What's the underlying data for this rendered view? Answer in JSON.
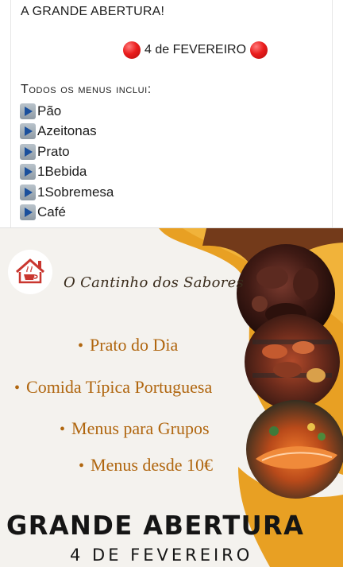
{
  "post": {
    "headline": "A GRANDE ABERTURA!",
    "date_text": "4 de FEVEREIRO",
    "menus_title": "Todos os menus inclui:",
    "menu_items": [
      "Pão",
      "Azeitonas",
      "Prato",
      "1Bebida",
      "1Sobremesa",
      "Café"
    ]
  },
  "flyer": {
    "brand_name": "O Cantinho dos Sabores",
    "bullets": [
      "Prato do Dia",
      "Comida Típica Portuguesa",
      "Menus para Grupos",
      "Menus desde 10€"
    ],
    "big_title": "GRANDE ABERTURA",
    "sub_title": "4 DE FEVEREIRO"
  },
  "colors": {
    "accent_orange": "#e8a023",
    "bullet_brown": "#b0660f",
    "dot_red": "#ea1d1d",
    "logo_red": "#c9362f"
  }
}
